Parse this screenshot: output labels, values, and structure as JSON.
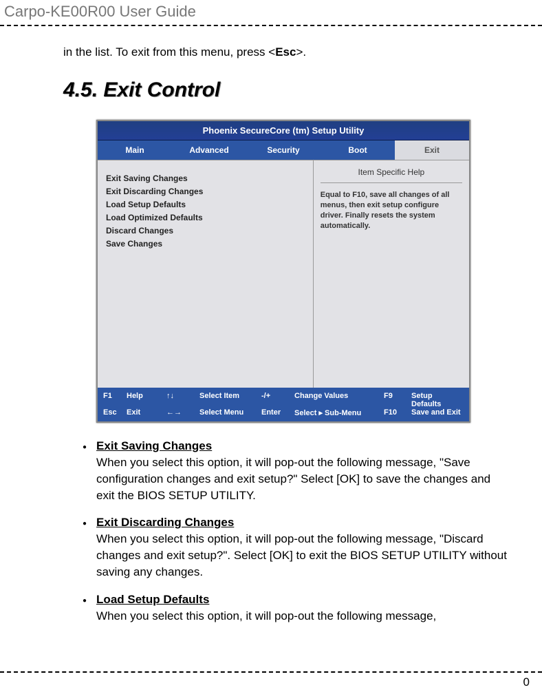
{
  "header_title": "Carpo-KE00R00  User  Guide",
  "intro_prefix": "in the list. To exit from this menu, press <",
  "intro_key": "Esc",
  "intro_suffix": ">.",
  "section_heading": "4.5. Exit Control",
  "bios": {
    "title": "Phoenix SecureCore (tm) Setup Utility",
    "tabs": [
      "Main",
      "Advanced",
      "Security",
      "Boot",
      "Exit"
    ],
    "active_tab": "Exit",
    "items": [
      "Exit Saving Changes",
      "Exit Discarding Changes",
      "Load Setup Defaults",
      "Load Optimized Defaults",
      "Discard Changes",
      "Save Changes"
    ],
    "help_title": "Item Specific Help",
    "help_body": "Equal to F10, save all changes of all menus, then exit setup configure driver. Finally resets the system automatically.",
    "footer": {
      "r1": {
        "k1": "F1",
        "l1": "Help",
        "sym1": "↑↓",
        "a1": "Select Item",
        "sym2": "-/+",
        "a2": "Change Values",
        "fk": "F9",
        "fa": "Setup Defaults"
      },
      "r2": {
        "k1": "Esc",
        "l1": "Exit",
        "sym1": "←→",
        "a1": "Select Menu",
        "sym2": "Enter",
        "a2": "Select ▸ Sub-Menu",
        "fk": "F10",
        "fa": "Save and Exit"
      }
    }
  },
  "bullets": [
    {
      "title": "Exit Saving Changes",
      "desc": "When you select this option, it will pop-out the following message, \"Save configuration changes and exit setup?\" Select [OK] to save the changes and exit the BIOS SETUP UTILITY."
    },
    {
      "title": "Exit Discarding Changes",
      "desc": "When you select this option, it will pop-out the following message, \"Discard changes and exit setup?\". Select [OK] to exit the BIOS SETUP UTILITY without saving any changes."
    },
    {
      "title": "Load Setup Defaults",
      "desc": "When you select this option, it will pop-out the following message,"
    }
  ],
  "page_number": "0"
}
